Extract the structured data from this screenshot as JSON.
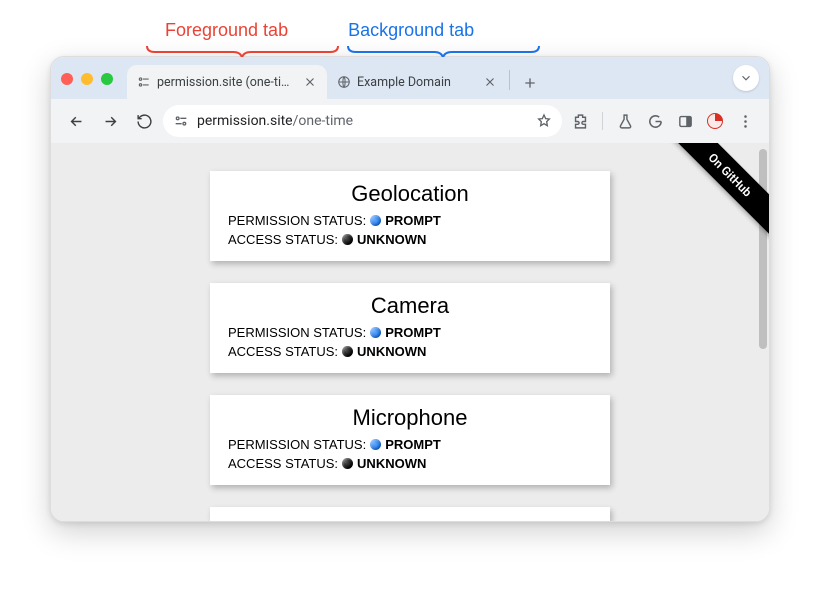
{
  "annotations": {
    "foreground": "Foreground tab",
    "background": "Background tab"
  },
  "tabs": [
    {
      "title": "permission.site (one-time)",
      "active": true
    },
    {
      "title": "Example Domain",
      "active": false
    }
  ],
  "omnibox": {
    "host": "permission.site",
    "path": "/one-time"
  },
  "ribbon": "On GitHub",
  "labels": {
    "permission_status": "PERMISSION STATUS:",
    "access_status": "ACCESS STATUS:"
  },
  "statuses": {
    "prompt": "PROMPT",
    "unknown": "UNKNOWN"
  },
  "cards": [
    {
      "title": "Geolocation",
      "permission": "prompt",
      "access": "unknown"
    },
    {
      "title": "Camera",
      "permission": "prompt",
      "access": "unknown"
    },
    {
      "title": "Microphone",
      "permission": "prompt",
      "access": "unknown"
    }
  ]
}
